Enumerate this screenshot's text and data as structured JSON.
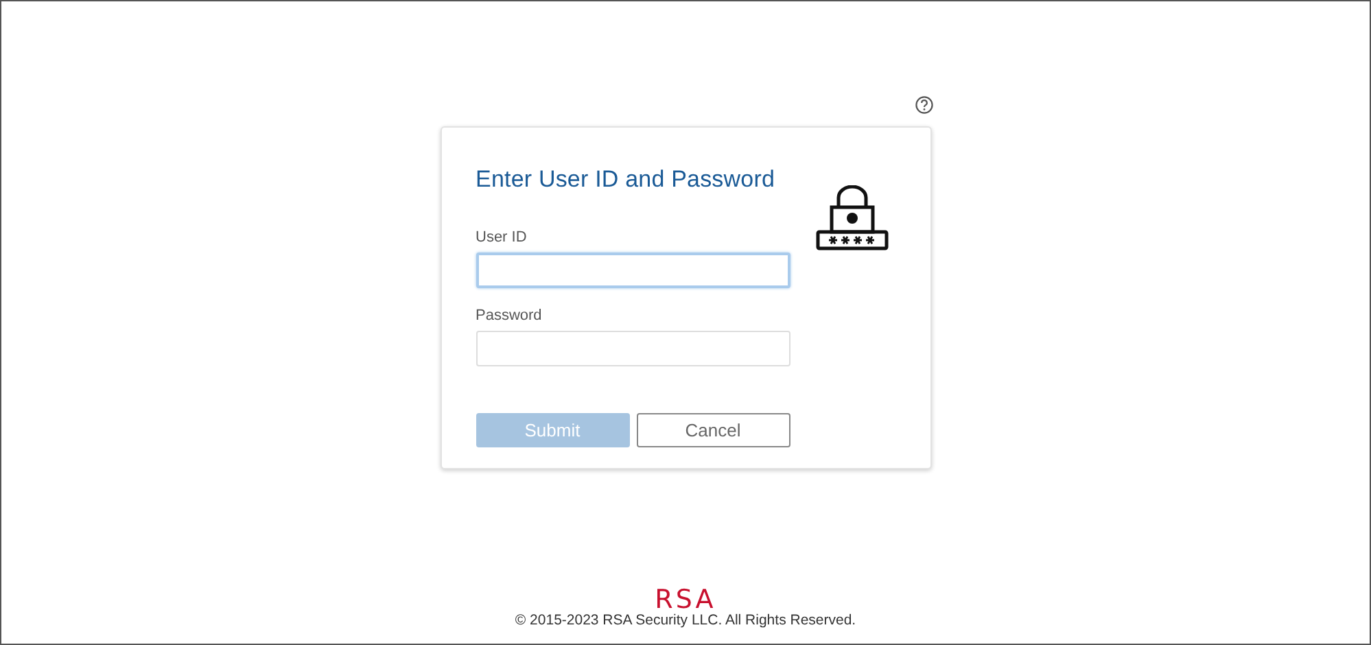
{
  "title": "Enter User ID and Password",
  "fields": [
    {
      "label": "User ID",
      "focused": true
    },
    {
      "label": "Password",
      "focused": false
    }
  ],
  "buttons": [
    {
      "label": "Submit",
      "kind": "primary",
      "disabled": true
    },
    {
      "label": "Cancel",
      "kind": "secondary",
      "disabled": false
    }
  ],
  "footer": {
    "logo": "RSA",
    "copyright": "© 2015-2023 RSA Security LLC. All Rights Reserved."
  }
}
